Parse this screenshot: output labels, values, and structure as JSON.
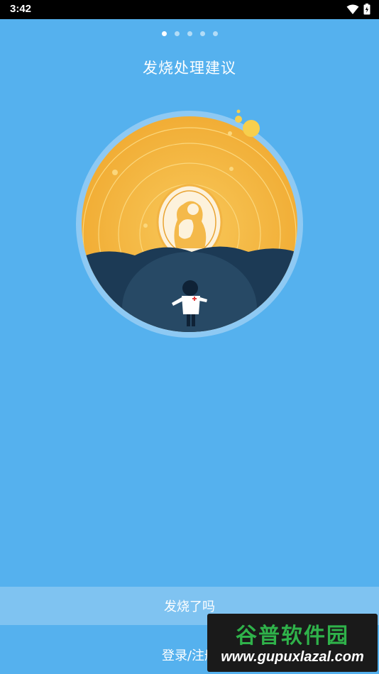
{
  "status_bar": {
    "time": "3:42",
    "icons": [
      "wifi-icon",
      "battery-icon"
    ]
  },
  "pager": {
    "count": 5,
    "active_index": 0
  },
  "title": "发烧处理建议",
  "buttons": {
    "fever_label": "发烧了吗",
    "login_label": "登录/注册"
  },
  "watermark": {
    "title": "谷普软件园",
    "url": "www.gupuxlazal.com"
  },
  "colors": {
    "background": "#55b1ee",
    "fever_button": "#7fc3f1",
    "sun": "#f5b335",
    "hills": "#1c3a55"
  }
}
